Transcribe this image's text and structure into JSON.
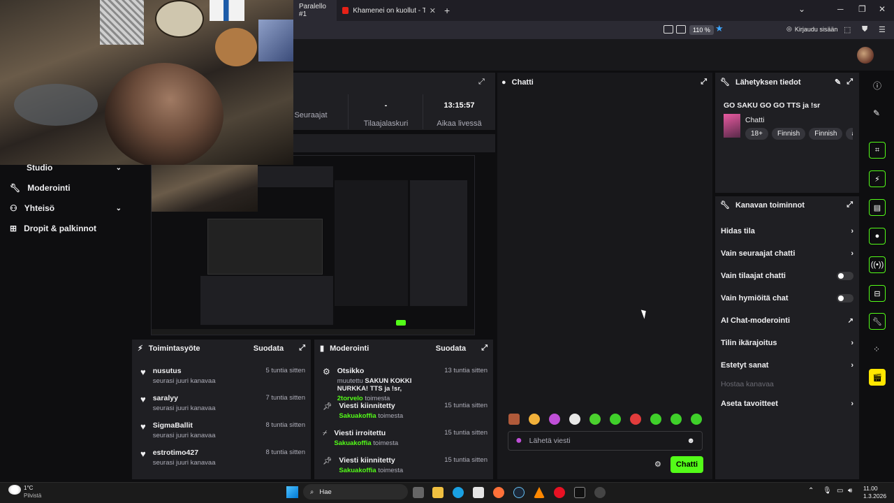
{
  "browser": {
    "tabs": [
      {
        "label": "Paralello #1"
      },
      {
        "label": "Khamenei on kuollut - Tämä tie"
      }
    ],
    "zoom": "110 %",
    "signin": "Kirjaudu sisään"
  },
  "stats": [
    {
      "value": "",
      "label": "Seuraajat"
    },
    {
      "value": "-",
      "label": "Tilaajalaskuri"
    },
    {
      "value": "13:15:57",
      "label": "Aikaa livessä"
    }
  ],
  "sidebar": {
    "items": [
      {
        "label": "Studio"
      },
      {
        "label": "Moderointi"
      },
      {
        "label": "Yhteisö"
      },
      {
        "label": "Dropit & palkinnot"
      }
    ]
  },
  "chat": {
    "title": "Chatti",
    "placeholder": "Lähetä viesti",
    "send": "Chatti"
  },
  "stream_info": {
    "title": "Lähetyksen tiedot",
    "stream_title": "GO SAKU GO GO TTS ja !sr",
    "category": "Chatti",
    "tags": [
      "18+",
      "Finnish",
      "Finnish",
      "al"
    ]
  },
  "channel_actions": {
    "title": "Kanavan toiminnot",
    "items": [
      {
        "label": "Hidas tila",
        "kind": "chevron"
      },
      {
        "label": "Vain seuraajat chatti",
        "kind": "chevron"
      },
      {
        "label": "Vain tilaajat chatti",
        "kind": "toggle"
      },
      {
        "label": "Vain hymiöitä chat",
        "kind": "toggle"
      },
      {
        "label": "AI Chat-moderointi",
        "kind": "external"
      },
      {
        "label": "Tilin ikärajoitus",
        "kind": "chevron"
      },
      {
        "label": "Estetyt sanat",
        "kind": "chevron"
      },
      {
        "label": "Hostaa kanavaa",
        "kind": "disabled"
      },
      {
        "label": "Aseta tavoitteet",
        "kind": "chevron"
      }
    ]
  },
  "activity": {
    "title": "Toimintasyöte",
    "filter": "Suodata",
    "items": [
      {
        "name": "nusutus",
        "sub": "seurasi juuri kanavaa",
        "time": "5 tuntia sitten"
      },
      {
        "name": "saralyy",
        "sub": "seurasi juuri kanavaa",
        "time": "7 tuntia sitten"
      },
      {
        "name": "SigmaBallit",
        "sub": "seurasi juuri kanavaa",
        "time": "8 tuntia sitten"
      },
      {
        "name": "estrotimo427",
        "sub": "seurasi juuri kanavaa",
        "time": "8 tuntia sitten"
      }
    ]
  },
  "moderation": {
    "title": "Moderointi",
    "filter": "Suodata",
    "items": [
      {
        "title": "Otsikko",
        "detail_prefix": "muutettu",
        "detail": "SAKUN KOKKI NURKKA! TTS ja !sr,",
        "by": "2torvelo",
        "by_suffix": "toimesta",
        "time": "13 tuntia sitten"
      },
      {
        "title": "Viesti kiinnitetty",
        "by": "Sakuakoffia",
        "by_suffix": "toimesta",
        "time": "15 tuntia sitten"
      },
      {
        "title": "Viesti irroitettu",
        "by": "Sakuakoffia",
        "by_suffix": "toimesta",
        "time": "15 tuntia sitten"
      },
      {
        "title": "Viesti kiinnitetty",
        "by": "Sakuakoffia",
        "by_suffix": "toimesta",
        "time": "15 tuntia sitten"
      }
    ]
  },
  "taskbar": {
    "weather_temp": "1°C",
    "weather_desc": "Pilvistä",
    "search": "Hae",
    "time": "11.00",
    "date": "1.3.2026"
  },
  "colors": {
    "accent": "#53fc18",
    "bg": "#0e0e10",
    "panel": "#1f1f23"
  }
}
